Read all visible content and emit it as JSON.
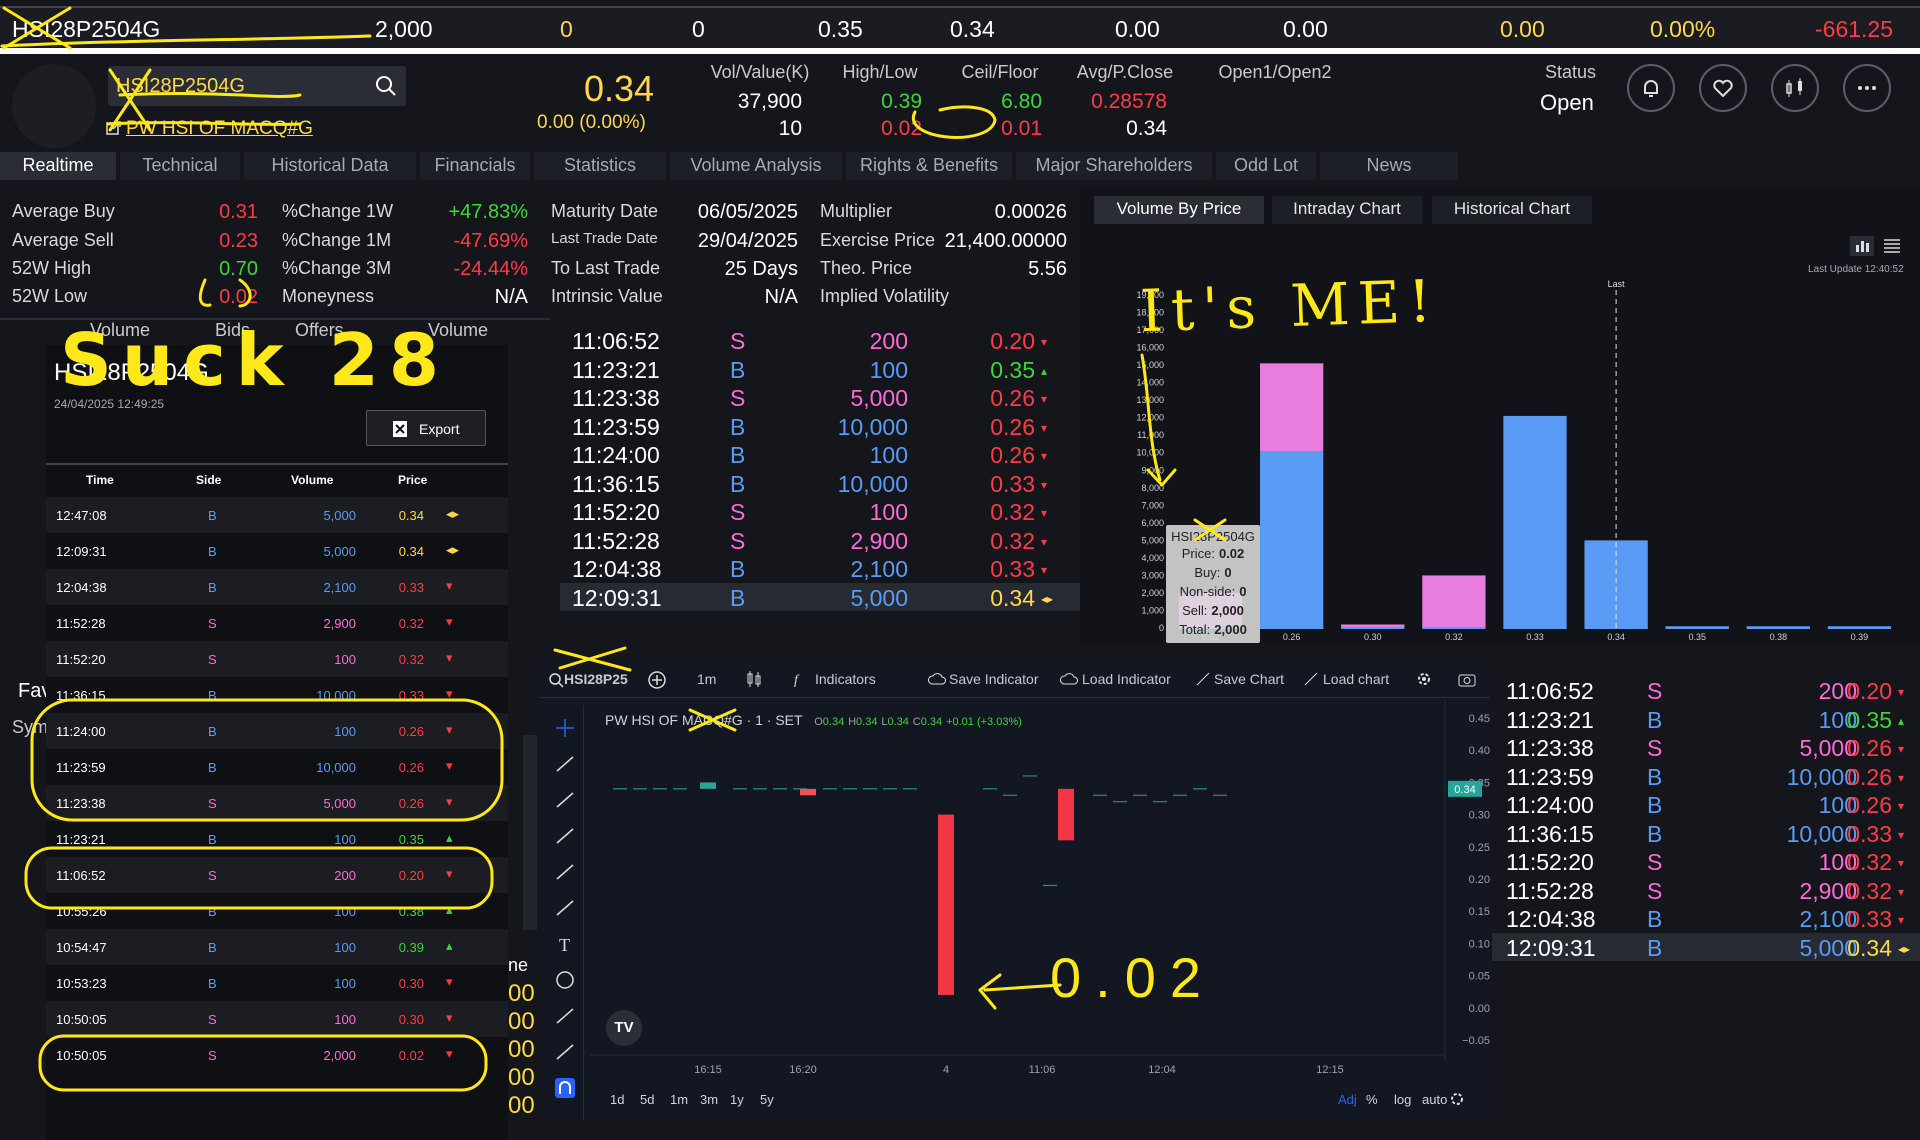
{
  "ticker": {
    "symbol": "HSI28P2504G",
    "vol": "2,000",
    "a": "0",
    "b": "0",
    "c": "0.35",
    "d": "0.34",
    "e": "0.00",
    "f": "0.00",
    "g": "0.00",
    "pct": "0.00%",
    "chg": "-661.25"
  },
  "header": {
    "symbol": "HSI28P2504G",
    "name": "PW HSI OF MACQ#G",
    "price": "0.34",
    "change": "0.00 (0.00%)",
    "cols": [
      {
        "label": "Vol/Value(K)",
        "v1": "37,900",
        "v2": "10",
        "c1": "#ffffff",
        "c2": "#ffffff"
      },
      {
        "label": "High/Low",
        "v1": "0.39",
        "v2": "0.02",
        "c1": "#3fd43b",
        "c2": "#ff3b45"
      },
      {
        "label": "Ceil/Floor",
        "v1": "6.80",
        "v2": "0.01",
        "c1": "#3fd43b",
        "c2": "#ff3b45"
      },
      {
        "label": "Avg/P.Close",
        "v1": "0.28578",
        "v2": "0.34",
        "c1": "#ff3b45",
        "c2": "#ffffff"
      },
      {
        "label": "Open1/Open2",
        "v1": "",
        "v2": "",
        "c1": "#ffffff",
        "c2": "#ffffff"
      }
    ],
    "status_label": "Status",
    "status_value": "Open",
    "icons": [
      "bell-icon",
      "heart-icon",
      "candlestick-icon",
      "more-icon"
    ]
  },
  "tabs": [
    "Realtime",
    "Technical",
    "Historical Data",
    "Financials",
    "Statistics",
    "Volume Analysis",
    "Rights & Benefits",
    "Major Shareholders",
    "Odd Lot",
    "News"
  ],
  "quote": {
    "left": [
      {
        "l": "Average Buy",
        "v": "0.31",
        "c": "#ff3b45"
      },
      {
        "l": "Average Sell",
        "v": "0.23",
        "c": "#ff3b45"
      },
      {
        "l": "52W High",
        "v": "0.70",
        "c": "#3fd43b"
      },
      {
        "l": "52W Low",
        "v": "0.02",
        "c": "#ff3b45"
      }
    ],
    "mid": [
      {
        "l": "%Change 1W",
        "v": "+47.83%",
        "c": "#3fd43b"
      },
      {
        "l": "%Change 1M",
        "v": "-47.69%",
        "c": "#ff3b45"
      },
      {
        "l": "%Change 3M",
        "v": "-24.44%",
        "c": "#ff3b45"
      },
      {
        "l": "Moneyness",
        "v": "N/A",
        "c": "#ffffff"
      }
    ],
    "right": [
      {
        "l": "Maturity Date",
        "v": "06/05/2025"
      },
      {
        "l": "Last Trade Date",
        "v": "29/04/2025"
      },
      {
        "l": "To Last Trade",
        "v": "25 Days"
      },
      {
        "l": "Intrinsic Value",
        "v": "N/A"
      }
    ],
    "far": [
      {
        "l": "Multiplier",
        "v": "0.00026"
      },
      {
        "l": "Exercise Price",
        "v": "21,400.00000"
      },
      {
        "l": "Theo. Price",
        "v": "5.56"
      },
      {
        "l": "Implied Volatility",
        "v": ""
      }
    ]
  },
  "book_headers": [
    "Volume",
    "Bids",
    "Offers",
    "Volume"
  ],
  "trades": [
    {
      "t": "11:06:52",
      "s": "S",
      "v": "200",
      "p": "0.20",
      "d": "down"
    },
    {
      "t": "11:23:21",
      "s": "B",
      "v": "100",
      "p": "0.35",
      "d": "up"
    },
    {
      "t": "11:23:38",
      "s": "S",
      "v": "5,000",
      "p": "0.26",
      "d": "down"
    },
    {
      "t": "11:23:59",
      "s": "B",
      "v": "10,000",
      "p": "0.26",
      "d": "down"
    },
    {
      "t": "11:24:00",
      "s": "B",
      "v": "100",
      "p": "0.26",
      "d": "down"
    },
    {
      "t": "11:36:15",
      "s": "B",
      "v": "10,000",
      "p": "0.33",
      "d": "down"
    },
    {
      "t": "11:52:20",
      "s": "S",
      "v": "100",
      "p": "0.32",
      "d": "down"
    },
    {
      "t": "11:52:28",
      "s": "S",
      "v": "2,900",
      "p": "0.32",
      "d": "down"
    },
    {
      "t": "12:04:38",
      "s": "B",
      "v": "2,100",
      "p": "0.33",
      "d": "down"
    },
    {
      "t": "12:09:31",
      "s": "B",
      "v": "5,000",
      "p": "0.34",
      "d": "flat"
    }
  ],
  "popup": {
    "title": "HSI28P2504G",
    "date": "24/04/2025 12:49:25",
    "export": "Export",
    "cols": [
      "Time",
      "Side",
      "Volume",
      "Price"
    ],
    "rows": [
      {
        "t": "12:47:08",
        "s": "B",
        "v": "5,000",
        "p": "0.34",
        "d": "flat"
      },
      {
        "t": "12:09:31",
        "s": "B",
        "v": "5,000",
        "p": "0.34",
        "d": "flat"
      },
      {
        "t": "12:04:38",
        "s": "B",
        "v": "2,100",
        "p": "0.33",
        "d": "down"
      },
      {
        "t": "11:52:28",
        "s": "S",
        "v": "2,900",
        "p": "0.32",
        "d": "down"
      },
      {
        "t": "11:52:20",
        "s": "S",
        "v": "100",
        "p": "0.32",
        "d": "down"
      },
      {
        "t": "11:36:15",
        "s": "B",
        "v": "10,000",
        "p": "0.33",
        "d": "down"
      },
      {
        "t": "11:24:00",
        "s": "B",
        "v": "100",
        "p": "0.26",
        "d": "down"
      },
      {
        "t": "11:23:59",
        "s": "B",
        "v": "10,000",
        "p": "0.26",
        "d": "down"
      },
      {
        "t": "11:23:38",
        "s": "S",
        "v": "5,000",
        "p": "0.26",
        "d": "down"
      },
      {
        "t": "11:23:21",
        "s": "B",
        "v": "100",
        "p": "0.35",
        "d": "up"
      },
      {
        "t": "11:06:52",
        "s": "S",
        "v": "200",
        "p": "0.20",
        "d": "down"
      },
      {
        "t": "10:55:26",
        "s": "B",
        "v": "100",
        "p": "0.38",
        "d": "up"
      },
      {
        "t": "10:54:47",
        "s": "B",
        "v": "100",
        "p": "0.39",
        "d": "up"
      },
      {
        "t": "10:53:23",
        "s": "B",
        "v": "100",
        "p": "0.30",
        "d": "down"
      },
      {
        "t": "10:50:05",
        "s": "S",
        "v": "100",
        "p": "0.30",
        "d": "down"
      },
      {
        "t": "10:50:05",
        "s": "S",
        "v": "2,000",
        "p": "0.02",
        "d": "down"
      }
    ]
  },
  "vbp": {
    "tabs": [
      "Volume By Price",
      "Intraday Chart",
      "Historical Chart"
    ],
    "last_update": "Last Update 12:40:52",
    "last_label": "Last",
    "tooltip": {
      "title": "HSI28P2504G",
      "lines": [
        [
          "Price:",
          "0.02"
        ],
        [
          "Buy:",
          "0"
        ],
        [
          "Non-side:",
          "0"
        ],
        [
          "Sell:",
          "2,000"
        ],
        [
          "Total:",
          "2,000"
        ]
      ]
    }
  },
  "chart_data": {
    "type": "bar",
    "categories": [
      "0.02",
      "0.26",
      "0.30",
      "0.32",
      "0.33",
      "0.34",
      "0.35",
      "0.38",
      "0.39"
    ],
    "series": [
      {
        "name": "Buy",
        "color": "#5a9bf5",
        "values": [
          0,
          10100,
          0,
          0,
          12100,
          5000,
          100,
          100,
          100
        ]
      },
      {
        "name": "Sell",
        "color": "#e87de0",
        "values": [
          2000,
          5000,
          200,
          3000,
          0,
          0,
          0,
          0,
          0
        ]
      }
    ],
    "ylim": [
      0,
      19000
    ],
    "yticks": [
      "19,000",
      "18,000",
      "17,000",
      "16,000",
      "15,000",
      "14,000",
      "13,000",
      "12,000",
      "11,000",
      "10,000",
      "9,000",
      "8,000",
      "7,000",
      "6,000",
      "5,000",
      "4,000",
      "3,000",
      "2,000",
      "1,000",
      "0"
    ]
  },
  "tv": {
    "symbol": "HSI28P25",
    "interval": "1m",
    "tools": [
      "Indicators",
      "Save Indicator",
      "Load Indicator",
      "Save Chart",
      "Load chart"
    ],
    "legend": {
      "name": "PW HSI OF MACQ#G · 1 · SET",
      "o": "0.34",
      "h": "0.34",
      "l": "0.34",
      "c": "0.34",
      "chg": "+0.01 (+3.03%)"
    },
    "yticks": [
      "0.45",
      "0.40",
      "0.35",
      "0.30",
      "0.25",
      "0.20",
      "0.15",
      "0.10",
      "0.05",
      "0.00",
      "−0.05"
    ],
    "last": "0.34",
    "xticks": [
      "16:15",
      "16:20",
      "4",
      "11:06",
      "12:04",
      "12:15"
    ],
    "ranges": [
      "1d",
      "5d",
      "1m",
      "3m",
      "1y",
      "5y"
    ],
    "opts": [
      "Adj",
      "%",
      "log",
      "auto"
    ]
  },
  "side_labels": {
    "fav": "Fav",
    "sym": "Sym",
    "ne": "ne"
  },
  "annotations": {
    "its_me": "It's ME!",
    "suck": "Suck 28",
    "arrow_val": "0.02"
  }
}
